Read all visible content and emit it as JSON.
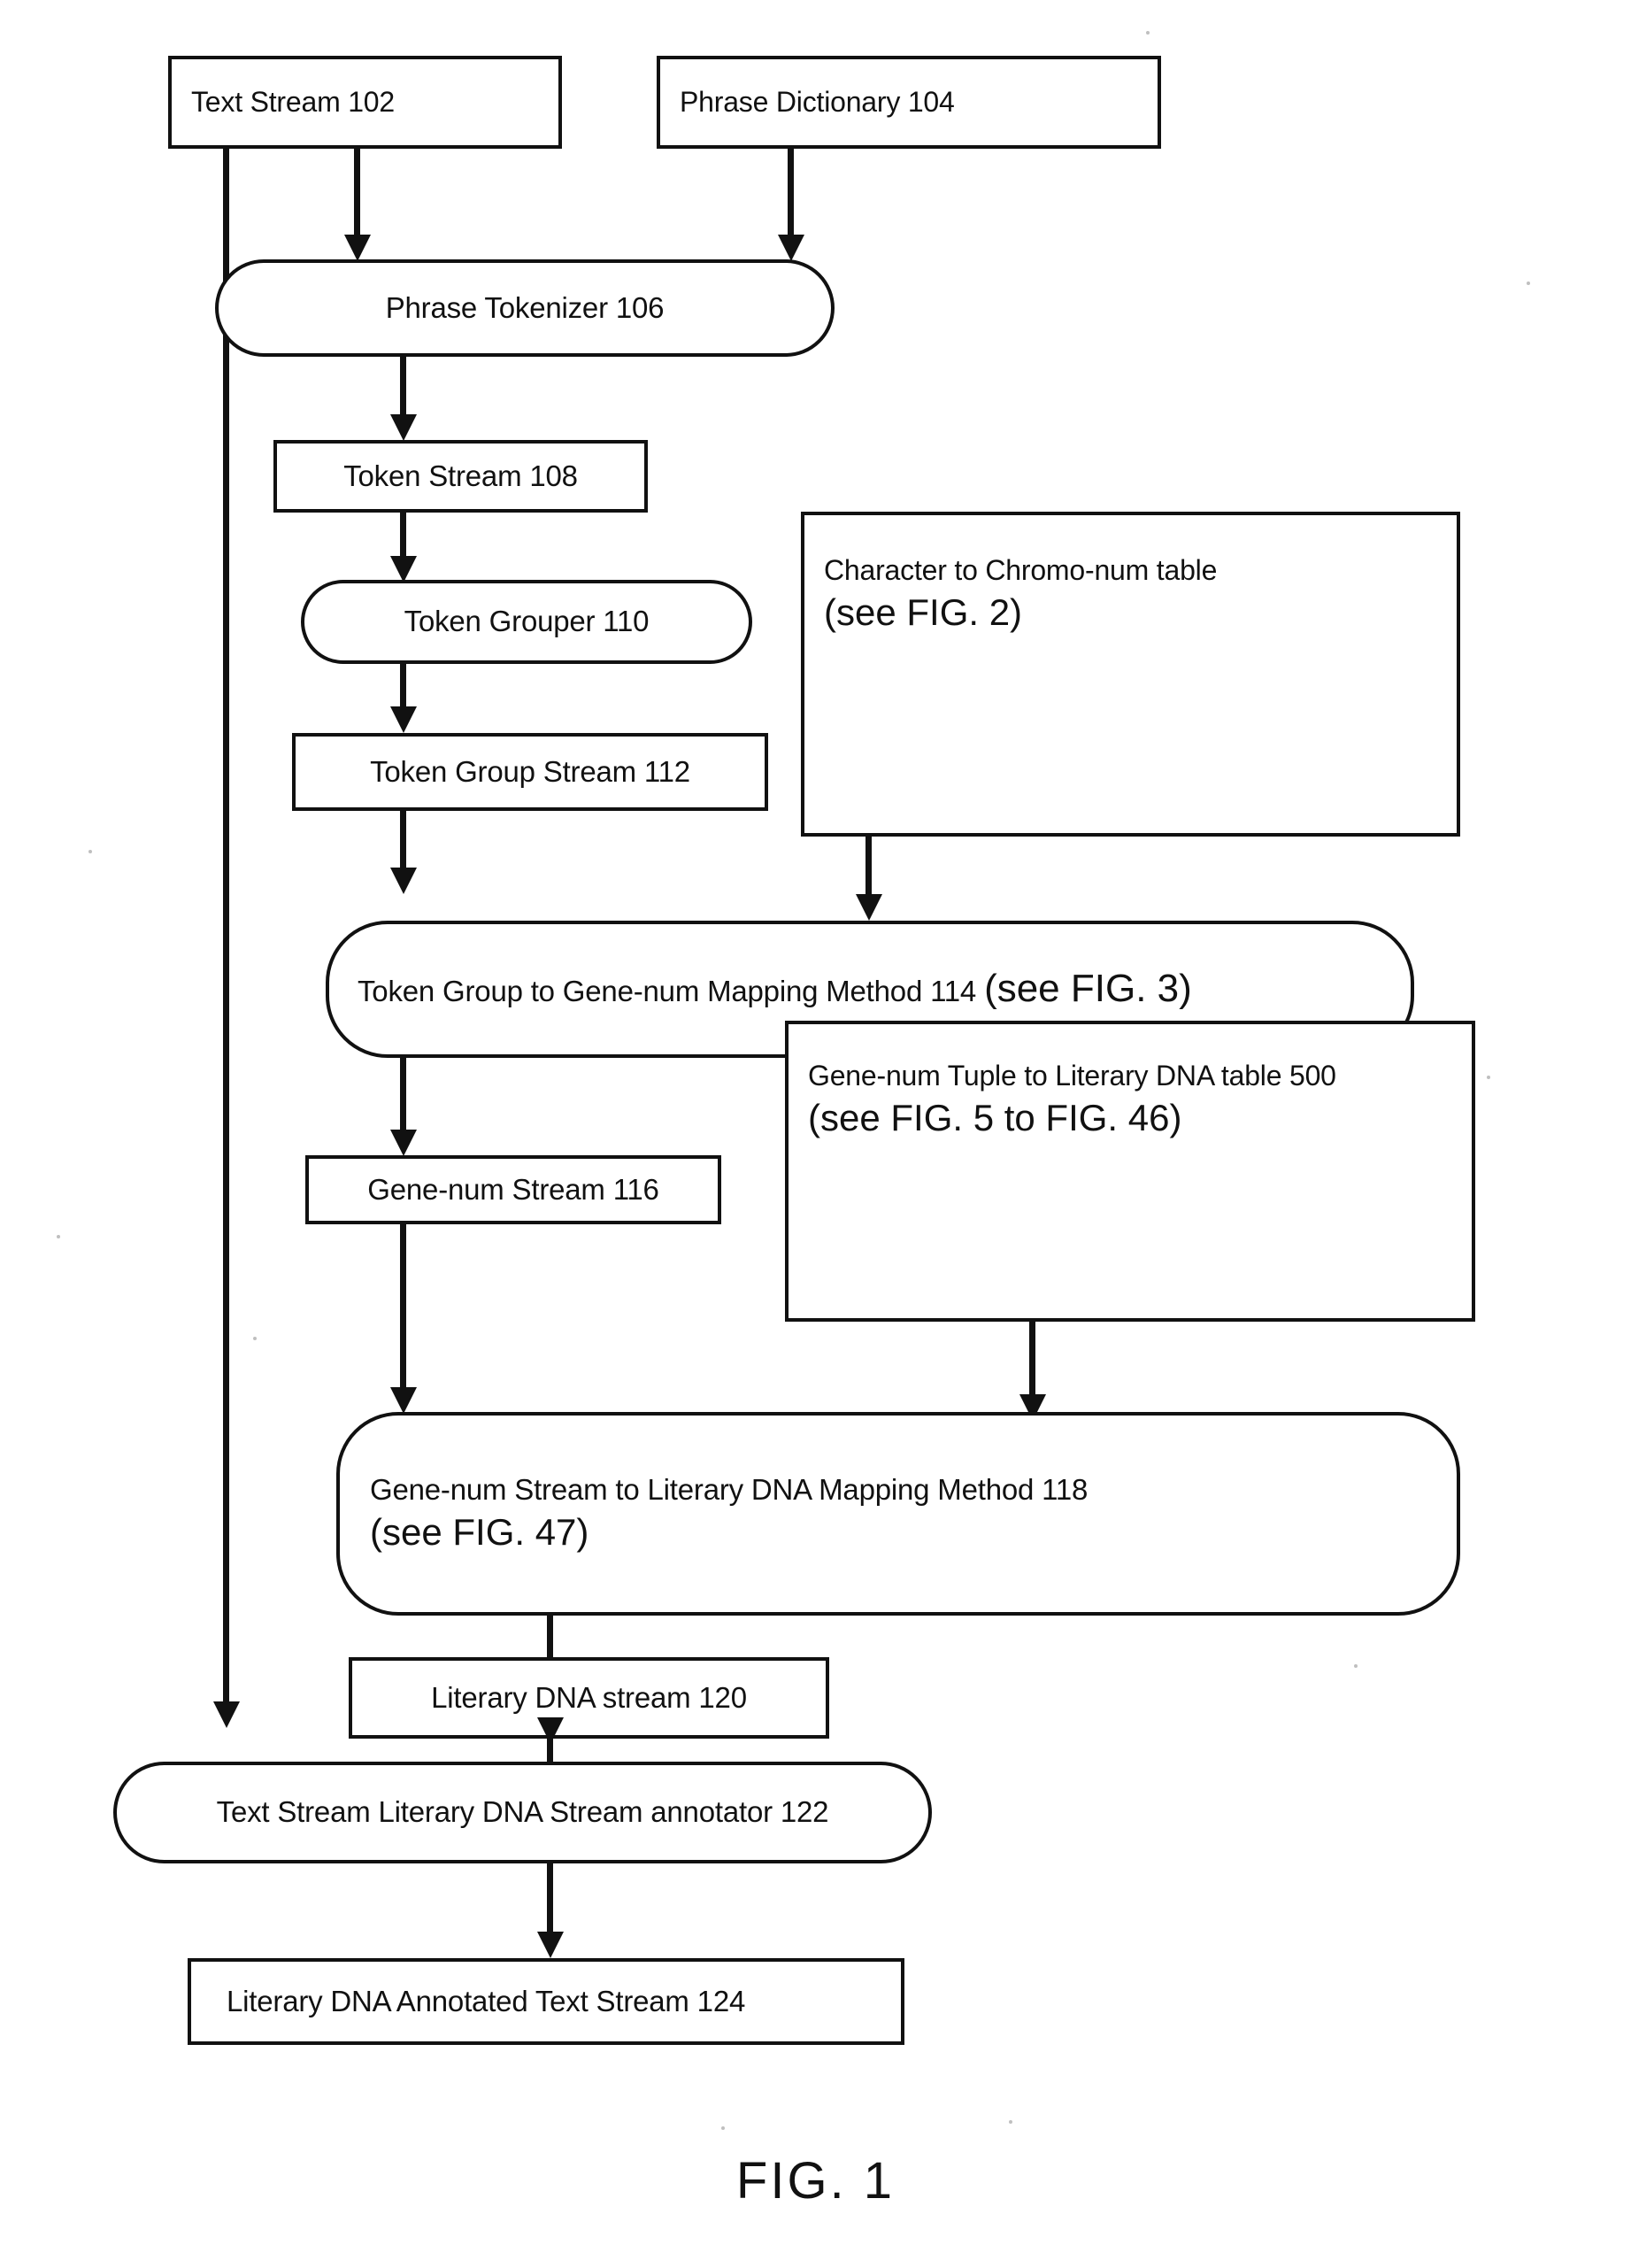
{
  "figure": {
    "caption": "FIG. 1",
    "title": "Literary DNA annotation pipeline flow diagram"
  },
  "nodes": {
    "text_stream_102": {
      "label": "Text Stream 102",
      "shape": "rectangle"
    },
    "phrase_dictionary_104": {
      "label": "Phrase Dictionary 104",
      "shape": "rectangle"
    },
    "phrase_tokenizer_106": {
      "label": "Phrase Tokenizer 106",
      "shape": "rounded"
    },
    "token_stream_108": {
      "label": "Token  Stream 108",
      "shape": "rectangle"
    },
    "token_grouper_110": {
      "label": "Token Grouper 110",
      "shape": "rounded"
    },
    "token_group_stream_112": {
      "label": "Token Group Stream 112",
      "shape": "rectangle"
    },
    "char_to_chromo_table": {
      "line1": "Character to Chromo-num table",
      "line2": "(see FIG. 2)",
      "shape": "rectangle"
    },
    "token_group_mapping_114": {
      "line1": "Token Group to Gene-num Mapping Method 114 ",
      "line1_emph": "(see FIG. 3)",
      "shape": "rounded"
    },
    "gene_num_stream_116": {
      "label": "Gene-num  Stream 116",
      "shape": "rectangle"
    },
    "gene_num_tuple_table_500": {
      "line1": "Gene-num Tuple to Literary DNA table 500",
      "line2": "(see FIG. 5 to FIG. 46)",
      "shape": "rectangle"
    },
    "gene_num_mapping_118": {
      "line1": "Gene-num Stream to Literary DNA Mapping Method 118",
      "line2": "(see FIG. 47)",
      "shape": "rounded"
    },
    "literary_dna_stream_120": {
      "label": "Literary DNA stream 120",
      "shape": "rectangle"
    },
    "annotator_122": {
      "label": "Text Stream Literary DNA Stream annotator 122",
      "shape": "rounded"
    },
    "annotated_text_stream_124": {
      "label": "Literary DNA Annotated Text Stream 124",
      "shape": "rectangle"
    }
  },
  "edges": [
    {
      "from": "text_stream_102",
      "to": "phrase_tokenizer_106"
    },
    {
      "from": "phrase_dictionary_104",
      "to": "phrase_tokenizer_106"
    },
    {
      "from": "phrase_tokenizer_106",
      "to": "token_stream_108"
    },
    {
      "from": "token_stream_108",
      "to": "token_grouper_110"
    },
    {
      "from": "token_grouper_110",
      "to": "token_group_stream_112"
    },
    {
      "from": "token_group_stream_112",
      "to": "token_group_mapping_114"
    },
    {
      "from": "char_to_chromo_table",
      "to": "token_group_mapping_114"
    },
    {
      "from": "token_group_mapping_114",
      "to": "gene_num_stream_116"
    },
    {
      "from": "gene_num_stream_116",
      "to": "gene_num_mapping_118"
    },
    {
      "from": "gene_num_tuple_table_500",
      "to": "gene_num_mapping_118"
    },
    {
      "from": "gene_num_mapping_118",
      "to": "literary_dna_stream_120"
    },
    {
      "from": "literary_dna_stream_120",
      "to": "annotator_122"
    },
    {
      "from": "text_stream_102",
      "to": "annotator_122"
    },
    {
      "from": "annotator_122",
      "to": "annotated_text_stream_124"
    }
  ],
  "colors": {
    "ink": "#111111",
    "paper": "#ffffff"
  }
}
